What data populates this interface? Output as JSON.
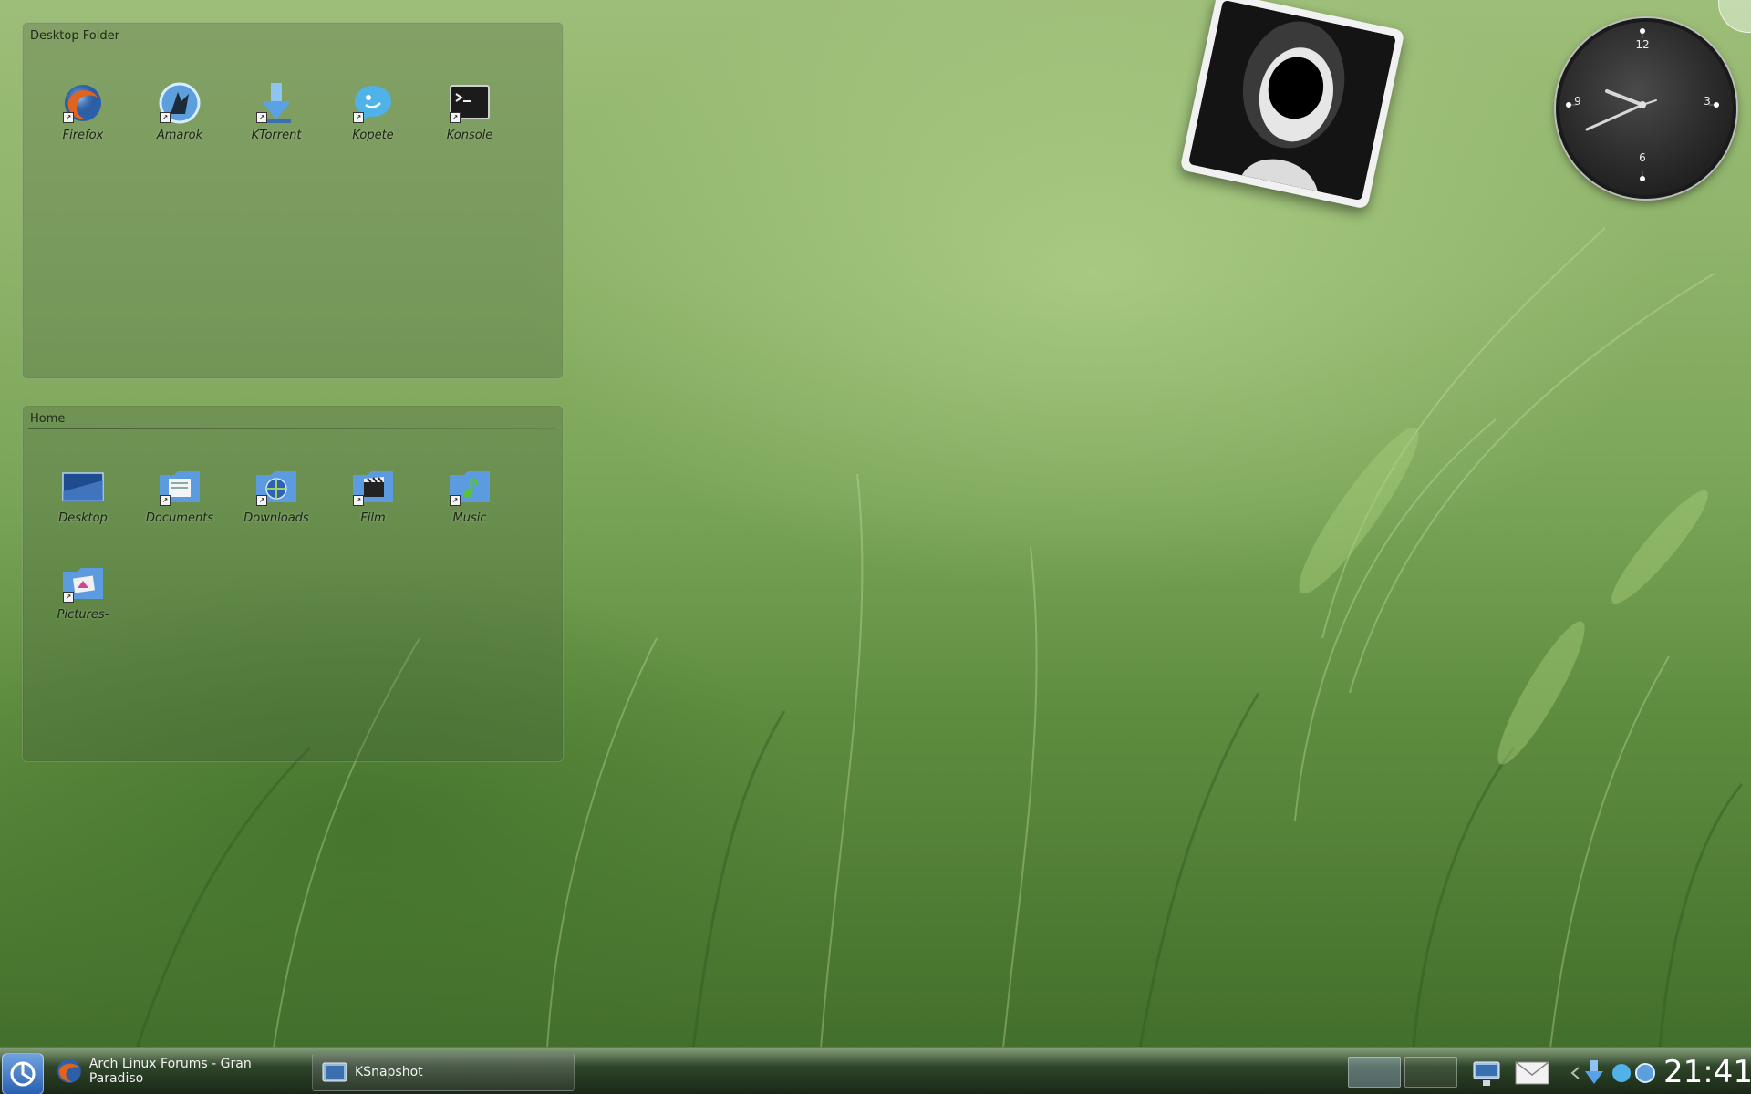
{
  "desktop_folder": {
    "title": "Desktop Folder",
    "icons": [
      {
        "label": "Firefox",
        "icon": "firefox-icon"
      },
      {
        "label": "Amarok",
        "icon": "amarok-icon"
      },
      {
        "label": "KTorrent",
        "icon": "ktorrent-icon"
      },
      {
        "label": "Kopete",
        "icon": "kopete-icon"
      },
      {
        "label": "Konsole",
        "icon": "konsole-icon"
      }
    ]
  },
  "home_folder": {
    "title": "Home",
    "icons": [
      {
        "label": "Desktop",
        "icon": "desktop-folder-icon"
      },
      {
        "label": "Documents",
        "icon": "documents-folder-icon"
      },
      {
        "label": "Downloads",
        "icon": "downloads-folder-icon"
      },
      {
        "label": "Film",
        "icon": "film-folder-icon"
      },
      {
        "label": "Music",
        "icon": "music-folder-icon"
      },
      {
        "label": "Pictures-",
        "icon": "pictures-folder-icon"
      }
    ]
  },
  "analog_clock": {
    "numbers": [
      "12",
      "3",
      "6",
      "9"
    ]
  },
  "taskbar": {
    "tasks": [
      {
        "label": "Arch Linux Forums - Gran Paradiso",
        "icon": "firefox-icon"
      },
      {
        "label": "KSnapshot",
        "icon": "ksnapshot-icon"
      }
    ],
    "clock": "21:41"
  },
  "colors": {
    "folder_icon": "#5c9be0",
    "taskbar_bg": "#1e2a1e",
    "accent": "#2a5fb0"
  }
}
